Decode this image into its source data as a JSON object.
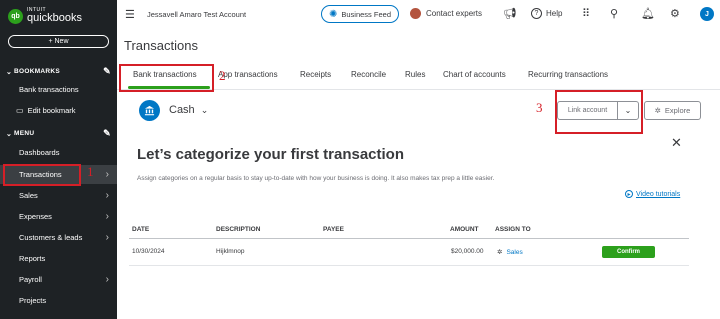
{
  "logo": {
    "line1": "INTUIT",
    "line2": "quickbooks",
    "badge": "qb"
  },
  "sidebar": {
    "new_label": "+ New",
    "bookmarks_label": "BOOKMARKS",
    "bookmark_items": [
      "Bank transactions",
      "Edit bookmark"
    ],
    "menu_label": "MENU",
    "menu_items": [
      "Dashboards",
      "Transactions",
      "Sales",
      "Expenses",
      "Customers & leads",
      "Reports",
      "Payroll",
      "Projects"
    ]
  },
  "header": {
    "account_name": "Jessavell Amaro Test Account",
    "business_feed": "Business Feed",
    "contact": "Contact experts",
    "help": "Help",
    "user_initial": "J"
  },
  "page_title": "Transactions",
  "tabs": [
    "Bank transactions",
    "App transactions",
    "Receipts",
    "Reconcile",
    "Rules",
    "Chart of accounts",
    "Recurring transactions"
  ],
  "account": {
    "name": "Cash",
    "link_account": "Link account",
    "explore": "Explore"
  },
  "promo": {
    "heading": "Let’s categorize your first transaction",
    "body": "Assign categories on a regular basis to stay up-to-date with how your business is doing. It also makes tax prep a little easier.",
    "video_link": "Video tutorials"
  },
  "table": {
    "headers": [
      "DATE",
      "DESCRIPTION",
      "PAYEE",
      "AMOUNT",
      "ASSIGN TO"
    ],
    "rows": [
      {
        "date": "10/30/2024",
        "description": "Hijklmnop",
        "payee": "",
        "amount": "$20,000.00",
        "assign_to": "Sales",
        "action": "Confirm"
      }
    ]
  },
  "annotations": [
    "1",
    "2",
    "3"
  ],
  "colors": {
    "brand_green": "#2ca01c",
    "accent_blue": "#0077c5",
    "sidebar_bg": "#1e2225",
    "annotation_red": "#d51f27"
  }
}
